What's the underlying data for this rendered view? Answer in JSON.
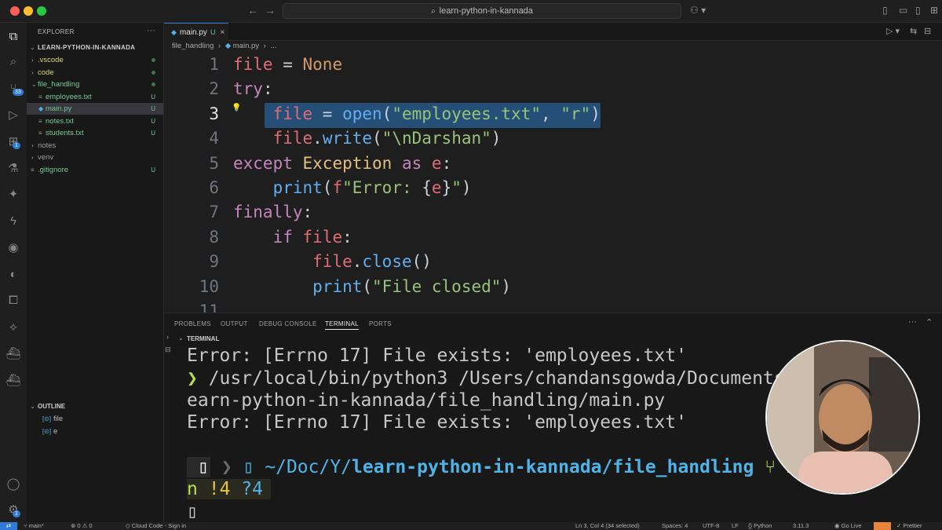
{
  "window": {
    "search_text": "learn-python-in-kannada"
  },
  "activity": {
    "source_control_badge": "33",
    "extensions_badge": "1",
    "accounts_badge": "1"
  },
  "sidebar": {
    "header": "EXPLORER",
    "root": "LEARN-PYTHON-IN-KANNADA",
    "items": [
      {
        "label": ".vscode",
        "status": "dot",
        "color": "#d9d66b"
      },
      {
        "label": "code",
        "status": "dot",
        "color": "#d9d66b"
      },
      {
        "label": "file_handling",
        "status": "dot",
        "color": "#73c991"
      },
      {
        "label": "employees.txt",
        "status": "U",
        "color": "#73c991"
      },
      {
        "label": "main.py",
        "status": "U",
        "color": "#73c991"
      },
      {
        "label": "notes.txt",
        "status": "U",
        "color": "#73c991"
      },
      {
        "label": "students.txt",
        "status": "U",
        "color": "#73c991"
      },
      {
        "label": "notes",
        "status": "",
        "color": "#9a9a9a"
      },
      {
        "label": "venv",
        "status": "",
        "color": "#9a9a9a"
      },
      {
        "label": ".gitignore",
        "status": "U",
        "color": "#73c991"
      }
    ],
    "outline_header": "OUTLINE",
    "outline": [
      "file",
      "e"
    ]
  },
  "tabs": [
    {
      "label": "main.py",
      "status": "U"
    }
  ],
  "breadcrumb": {
    "folder": "file_handling",
    "file": "main.py",
    "more": "..."
  },
  "editor": {
    "lines": [
      {
        "n": "1",
        "tokens": [
          [
            "vr",
            "file"
          ],
          [
            "pl",
            " = "
          ],
          [
            "cn",
            "None"
          ]
        ]
      },
      {
        "n": "2",
        "tokens": [
          [
            "kw",
            "try"
          ],
          [
            "pl",
            ":"
          ]
        ]
      },
      {
        "n": "3",
        "tokens": [
          [
            "pl",
            "    "
          ],
          [
            "vr",
            "file"
          ],
          [
            "pl",
            " = "
          ],
          [
            "fn",
            "open"
          ],
          [
            "pl",
            "("
          ],
          [
            "st-s",
            "\"employees.txt\""
          ],
          [
            "pl",
            ", "
          ],
          [
            "st-s",
            "\"r\""
          ],
          [
            "pl",
            ")"
          ]
        ]
      },
      {
        "n": "4",
        "tokens": [
          [
            "pl",
            "    "
          ],
          [
            "vr",
            "file"
          ],
          [
            "pl",
            "."
          ],
          [
            "fn",
            "write"
          ],
          [
            "pl",
            "("
          ],
          [
            "st-s",
            "\"\\nDarshan\""
          ],
          [
            "pl",
            ")"
          ]
        ]
      },
      {
        "n": "5",
        "tokens": [
          [
            "kw",
            "except"
          ],
          [
            "pl",
            " "
          ],
          [
            "ex",
            "Exception"
          ],
          [
            "pl",
            " "
          ],
          [
            "kw",
            "as"
          ],
          [
            "pl",
            " "
          ],
          [
            "vr",
            "e"
          ],
          [
            "pl",
            ":"
          ]
        ]
      },
      {
        "n": "6",
        "tokens": [
          [
            "pl",
            "    "
          ],
          [
            "fn",
            "print"
          ],
          [
            "pl",
            "("
          ],
          [
            "vr",
            "f"
          ],
          [
            "st-s",
            "\"Error: "
          ],
          [
            "pl",
            "{"
          ],
          [
            "vr",
            "e"
          ],
          [
            "pl",
            "}"
          ],
          [
            "st-s",
            "\""
          ],
          [
            "pl",
            ")"
          ]
        ]
      },
      {
        "n": "7",
        "tokens": [
          [
            "kw",
            "finally"
          ],
          [
            "pl",
            ":"
          ]
        ]
      },
      {
        "n": "8",
        "tokens": [
          [
            "pl",
            "    "
          ],
          [
            "kw",
            "if"
          ],
          [
            "pl",
            " "
          ],
          [
            "vr",
            "file"
          ],
          [
            "pl",
            ":"
          ]
        ]
      },
      {
        "n": "9",
        "tokens": [
          [
            "pl",
            "        "
          ],
          [
            "vr",
            "file"
          ],
          [
            "pl",
            "."
          ],
          [
            "fn",
            "close"
          ],
          [
            "pl",
            "()"
          ]
        ]
      },
      {
        "n": "10",
        "tokens": [
          [
            "pl",
            "        "
          ],
          [
            "fn",
            "print"
          ],
          [
            "pl",
            "("
          ],
          [
            "st-s",
            "\"File closed\""
          ],
          [
            "pl",
            ")"
          ]
        ]
      },
      {
        "n": "11",
        "tokens": []
      }
    ]
  },
  "panel": {
    "tabs": [
      "PROBLEMS",
      "OUTPUT",
      "DEBUG CONSOLE",
      "TERMINAL",
      "PORTS"
    ],
    "active_tab": "TERMINAL",
    "terminal_header": "TERMINAL",
    "terminal": {
      "line1": "Error: [Errno 17] File exists: 'employees.txt'",
      "prompt_glyph": "❯",
      "cmd_part1": " /usr/local/bin/python3 ",
      "cmd_part2": "/Users/chandansgowda/Documents/Youtube/l",
      "cmd_part3": "earn-python-in-kannada/file_handling/main.py",
      "line4": "Error: [Errno 17] File exists: 'employees.txt'",
      "prompt_path_dim": "~/Doc/Y/",
      "prompt_path": "learn-python-in-kannada/file_handling",
      "prompt_branch": "main",
      "prompt_branch_tail": "n",
      "git_modified": "!4",
      "git_untracked": "?4"
    }
  },
  "status": {
    "branch": "main*",
    "problems": "0 ⚠ 0",
    "cloud": "Cloud Code - Sign in",
    "cursor": "Ln 3, Col 4 (34 selected)",
    "spaces": "Spaces: 4",
    "encoding": "UTF-8",
    "eol": "LF",
    "language": "Python",
    "version": "3.11.3",
    "golive": "Go Live",
    "prettier": "Prettier"
  }
}
